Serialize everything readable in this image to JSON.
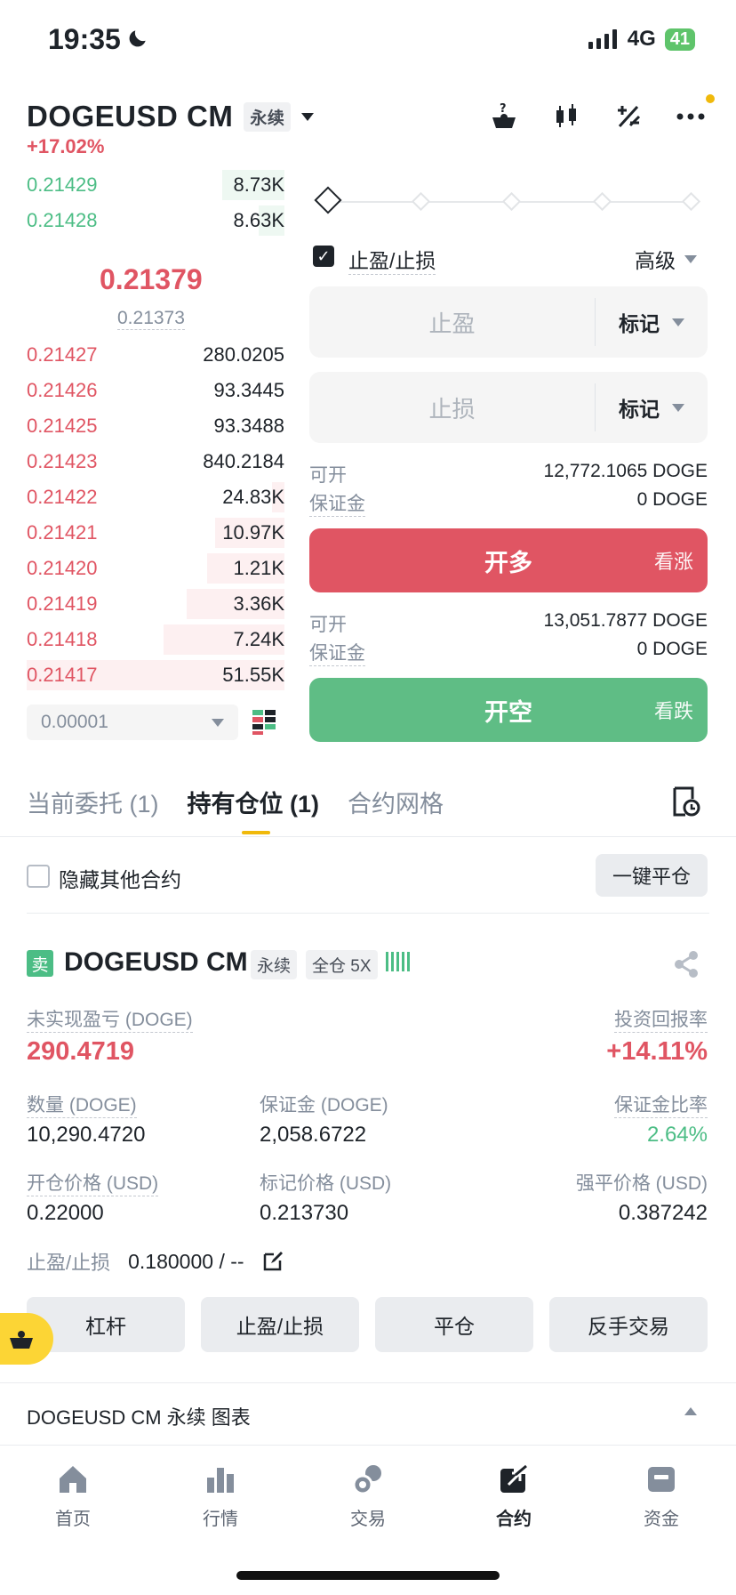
{
  "status_bar": {
    "time": "19:35",
    "network": "4G",
    "battery": "41"
  },
  "header": {
    "pair": "DOGEUSD CM",
    "contract_type": "永续",
    "change": "+17.02%",
    "icons": [
      "futures-grid-icon",
      "candlestick-icon",
      "calculator-icon",
      "more-icon"
    ]
  },
  "orderbook": {
    "asks": [
      {
        "price": "0.21429",
        "qty": "8.73K",
        "depth": 0.24
      },
      {
        "price": "0.21428",
        "qty": "8.63K",
        "depth": 0.1
      }
    ],
    "last_price": "0.21379",
    "mark_price": "0.21373",
    "bids": [
      {
        "price": "0.21427",
        "qty": "280.0205",
        "depth": 0.0
      },
      {
        "price": "0.21426",
        "qty": "93.3445",
        "depth": 0.0
      },
      {
        "price": "0.21425",
        "qty": "93.3488",
        "depth": 0.0
      },
      {
        "price": "0.21423",
        "qty": "840.2184",
        "depth": 0.0
      },
      {
        "price": "0.21422",
        "qty": "24.83K",
        "depth": 0.05
      },
      {
        "price": "0.21421",
        "qty": "10.97K",
        "depth": 0.27
      },
      {
        "price": "0.21420",
        "qty": "1.21K",
        "depth": 0.3
      },
      {
        "price": "0.21419",
        "qty": "3.36K",
        "depth": 0.38
      },
      {
        "price": "0.21418",
        "qty": "7.24K",
        "depth": 0.47
      },
      {
        "price": "0.21417",
        "qty": "51.55K",
        "depth": 1.0
      }
    ],
    "precision": "0.00001"
  },
  "form": {
    "tpsl_label": "止盈/止损",
    "advanced": "高级",
    "tp_placeholder": "止盈",
    "sl_placeholder": "止损",
    "trigger_type": "标记",
    "long": {
      "avail_label": "可开",
      "avail_value": "12,772.1065 DOGE",
      "margin_label": "保证金",
      "margin_value": "0 DOGE",
      "button": "开多",
      "sub": "看涨"
    },
    "short": {
      "avail_label": "可开",
      "avail_value": "13,051.7877 DOGE",
      "margin_label": "保证金",
      "margin_value": "0 DOGE",
      "button": "开空",
      "sub": "看跌"
    }
  },
  "tabs": [
    "当前委托 (1)",
    "持有仓位 (1)",
    "合约网格"
  ],
  "hide_others": "隐藏其他合约",
  "close_all": "一键平仓",
  "position": {
    "side": "卖",
    "pair": "DOGEUSD CM",
    "type": "永续",
    "margin_mode": "全仓 5X",
    "pnl_label": "未实现盈亏 (DOGE)",
    "pnl_value": "290.4719",
    "roe_label": "投资回报率",
    "roe_value": "+14.11%",
    "qty_label": "数量 (DOGE)",
    "qty_value": "10,290.4720",
    "margin_label": "保证金 (DOGE)",
    "margin_value": "2,058.6722",
    "ratio_label": "保证金比率",
    "ratio_value": "2.64%",
    "entry_label": "开仓价格 (USD)",
    "entry_value": "0.22000",
    "mark_label": "标记价格 (USD)",
    "mark_value": "0.213730",
    "liq_label": "强平价格 (USD)",
    "liq_value": "0.387242",
    "tpsl_label": "止盈/止损",
    "tpsl_value": "0.180000 / --",
    "actions": [
      "杠杆",
      "止盈/止损",
      "平仓",
      "反手交易"
    ]
  },
  "chart_bar": {
    "label": "DOGEUSD CM 永续  图表"
  },
  "nav": [
    {
      "label": "首页",
      "icon": "home-icon"
    },
    {
      "label": "行情",
      "icon": "markets-icon"
    },
    {
      "label": "交易",
      "icon": "trade-icon"
    },
    {
      "label": "合约",
      "icon": "futures-icon",
      "active": true
    },
    {
      "label": "资金",
      "icon": "wallet-icon"
    }
  ],
  "colors": {
    "red": "#e05563",
    "green": "#5fbd85",
    "yellow": "#f0b90b"
  }
}
